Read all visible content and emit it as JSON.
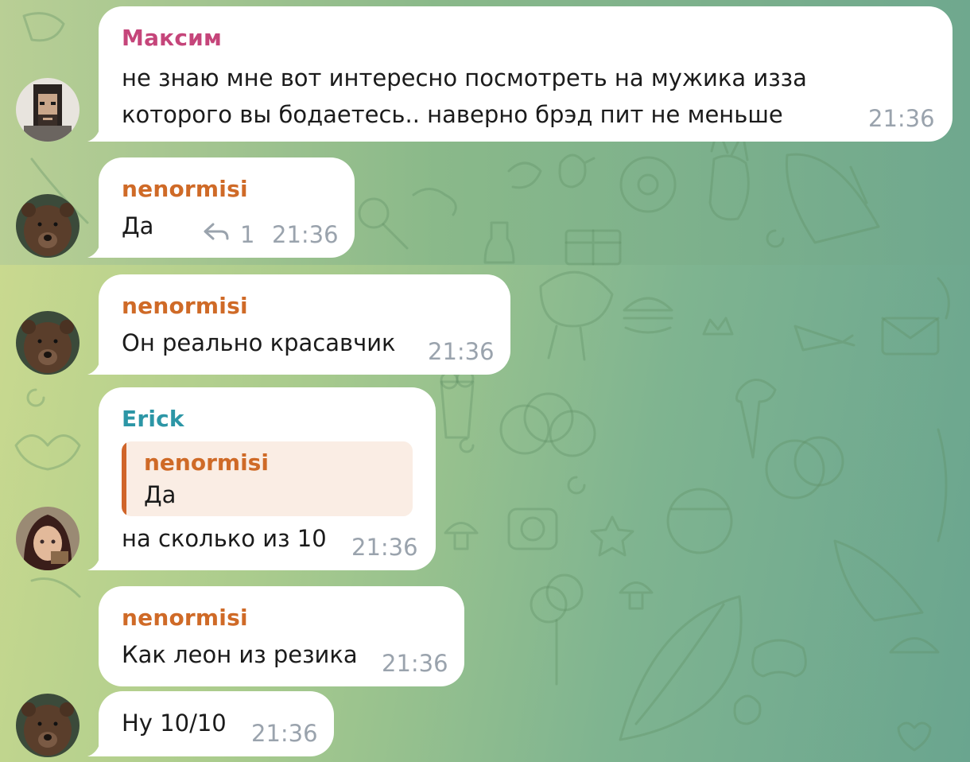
{
  "colors": {
    "maksim": "#c5457a",
    "nenormisi": "#cf6a27",
    "erick": "#2c96a6"
  },
  "messages": [
    {
      "sender": "Максим",
      "lines": [
        "не знаю мне вот интересно посмотреть на мужика изза",
        "которого вы бодаетесь.. наверно брэд пит не меньше"
      ],
      "time": "21:36"
    },
    {
      "sender": "nenormisi",
      "text": "Да",
      "reply_count": "1",
      "time": "21:36"
    },
    {
      "sender": "nenormisi",
      "text": "Он реально красавчик",
      "time": "21:36"
    },
    {
      "sender": "Erick",
      "quote": {
        "sender": "nenormisi",
        "text": "Да"
      },
      "text": "на сколько из 10",
      "time": "21:36"
    },
    {
      "sender": "nenormisi",
      "text": "Как леон из резика",
      "time": "21:36"
    },
    {
      "text": "Ну 10/10",
      "time": "21:36"
    }
  ]
}
